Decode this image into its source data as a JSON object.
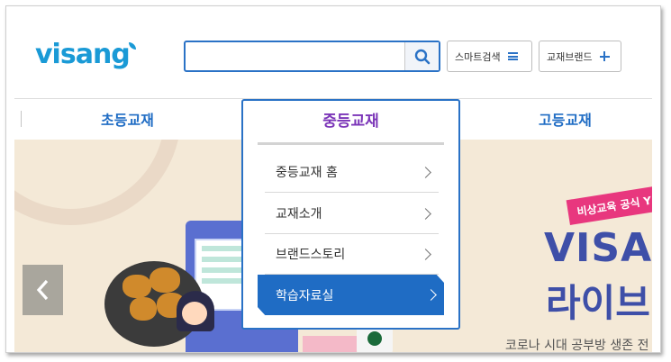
{
  "header": {
    "logo_text": "visang",
    "search": {
      "placeholder": "",
      "value": ""
    },
    "smart_search_label": "스마트검색",
    "brand_label": "교재브랜드"
  },
  "nav": {
    "items": [
      {
        "label": "초등교재"
      },
      {
        "label": "중등교재"
      },
      {
        "label": "고등교재"
      }
    ]
  },
  "dropdown": {
    "title": "중등교재",
    "items": [
      {
        "label": "중등교재 홈"
      },
      {
        "label": "교재소개"
      },
      {
        "label": "브랜드스토리"
      },
      {
        "label": "학습자료실"
      }
    ],
    "active_index": 3
  },
  "banner": {
    "tag": "비상교육 공식 Y",
    "headline1": "VISAI",
    "headline2": "라이브",
    "subtext": "코로나 시대 공부방 생존 전"
  },
  "colors": {
    "brand": "#1a9ad6",
    "accent": "#2a72c6",
    "nav_text": "#1f6cc4",
    "dropdown_title": "#7b35b8",
    "banner_bg": "#f4e9d7"
  },
  "icons": [
    "search-icon",
    "menu-icon",
    "plus-icon",
    "chevron-right-icon",
    "chevron-left-icon"
  ]
}
